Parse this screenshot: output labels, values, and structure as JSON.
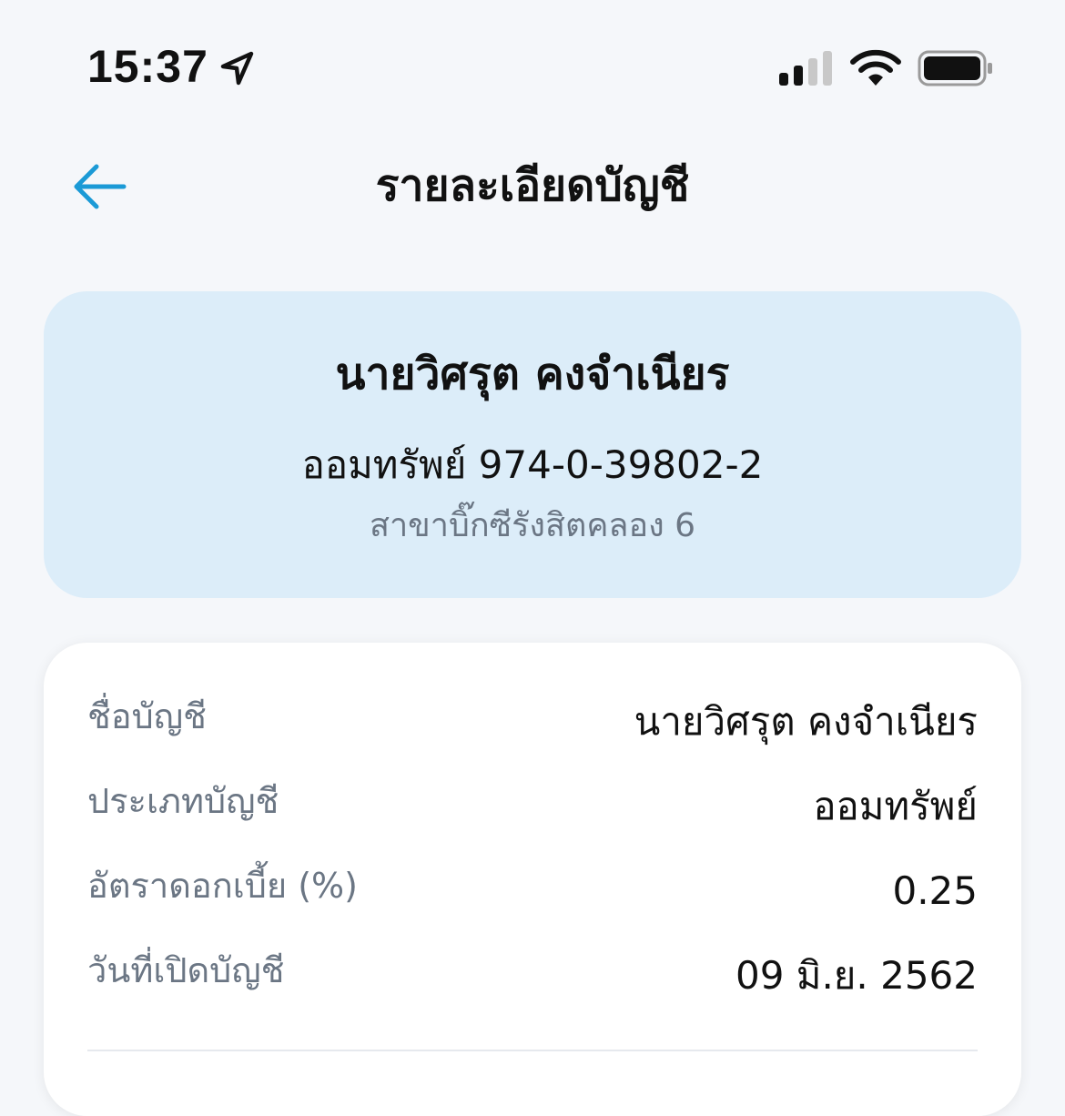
{
  "status_bar": {
    "time": "15:37",
    "icons": [
      "location-arrow-icon",
      "signal-icon",
      "wifi-icon",
      "battery-icon"
    ]
  },
  "header": {
    "back_icon": "arrow-left-icon",
    "title": "รายละเอียดบัญชี"
  },
  "summary": {
    "account_name": "นายวิศรุต คงจำเนียร",
    "account_type_number": "ออมทรัพย์ 974-0-39802-2",
    "branch": "สาขาบิ๊กซีรังสิตคลอง 6"
  },
  "details": {
    "rows": [
      {
        "label": "ชื่อบัญชี",
        "value": "นายวิศรุต คงจำเนียร"
      },
      {
        "label": "ประเภทบัญชี",
        "value": "ออมทรัพย์"
      },
      {
        "label": "อัตราดอกเบี้ย (%)",
        "value": "0.25"
      },
      {
        "label": "วันที่เปิดบัญชี",
        "value": "09 มิ.ย. 2562"
      }
    ]
  },
  "colors": {
    "accent": "#1b9ad6",
    "background": "#f5f7fa",
    "summary_card": "#dcedf9",
    "label_gray": "#6b7684"
  }
}
